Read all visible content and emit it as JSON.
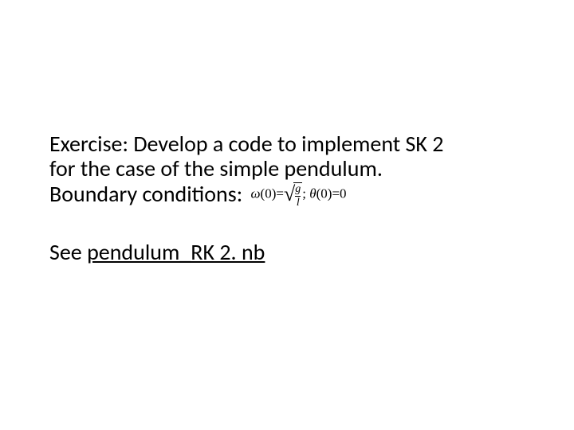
{
  "slide": {
    "body": {
      "line1": "Exercise: Develop a code to implement SK 2",
      "line2": "for the case of the simple pendulum.",
      "line3_prefix": "Boundary conditions:"
    },
    "equation": {
      "omega": "ω",
      "lpar": "(",
      "zero1": "0",
      "rpar": ")",
      "eq1": "=",
      "frac_top": "g",
      "frac_bot": "l",
      "sep": ";",
      "theta": "θ",
      "lpar2": "(",
      "zero2": "0",
      "rpar2": ")",
      "eq2": "=",
      "zero3": "0"
    },
    "see": {
      "prefix": "See ",
      "filename": "pendulum_RK 2. nb"
    }
  }
}
